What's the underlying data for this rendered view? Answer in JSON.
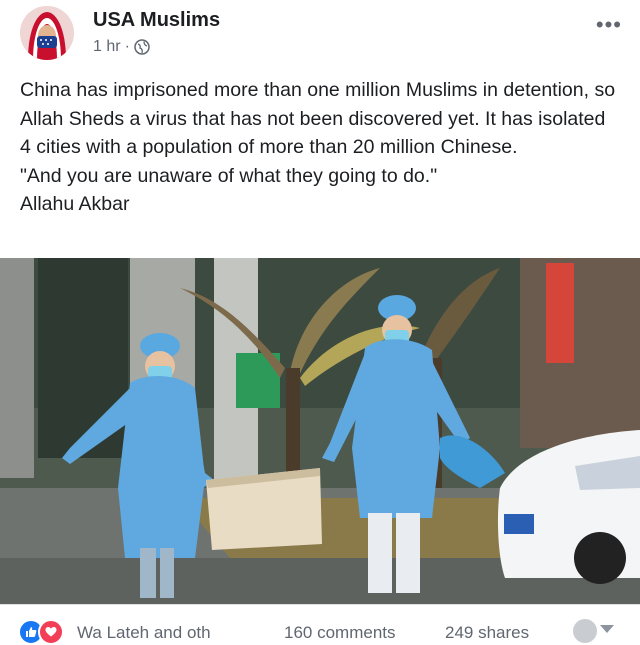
{
  "post": {
    "author": "USA Muslims",
    "time": "1 hr",
    "separator": "·",
    "privacy_icon": "globe-icon",
    "more_icon": "more-options-icon",
    "text": "China has imprisoned more than  one million Muslims in detention, so Allah Sheds a virus that has not been discovered yet. It has isolated 4 cities with a population of more than 20 million Chinese.\n \"And you are unaware of what they going to do.\"\nAllahu Akbar"
  },
  "footer": {
    "reactions": [
      "like-icon",
      "love-icon"
    ],
    "reactors_text": "Wa Lateh and oth",
    "comments": "160 comments",
    "shares": "249 shares"
  },
  "colors": {
    "text": "#1c1e21",
    "secondary": "#606770",
    "like": "#1877f2",
    "love": "#f33e58",
    "suit": "#5fa9e0"
  }
}
